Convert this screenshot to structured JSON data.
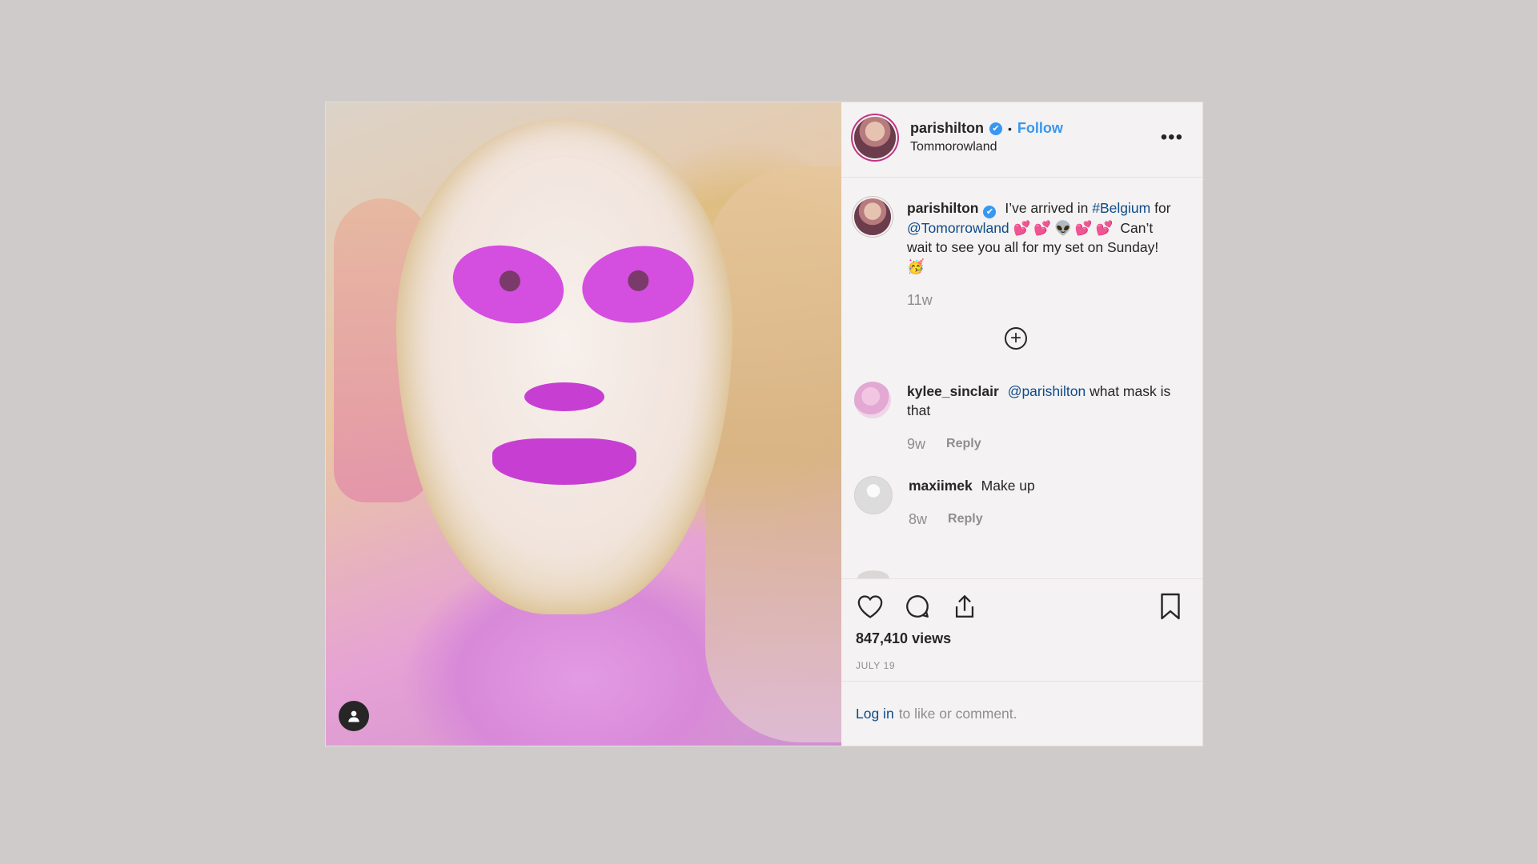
{
  "post": {
    "author": {
      "username": "parishilton",
      "verified_badge": "✔",
      "separator": "•",
      "follow_label": "Follow",
      "location": "Tommorowland"
    },
    "more_options": "•••",
    "caption": {
      "username": "parishilton",
      "verified_badge": "✔",
      "text_1": "I’ve arrived in",
      "hashtag": "#Belgium",
      "text_2": "for",
      "mention": "@Tomorrowland",
      "emojis": "💕💕👽💕💕",
      "text_3": "Can’t wait to see you all for my set on Sunday!",
      "trailing_emoji": "🥳",
      "time": "11w"
    },
    "comments": [
      {
        "username": "kylee_sinclair",
        "mention": "@parishilton",
        "text": "what mask is that",
        "time": "9w",
        "reply_label": "Reply"
      },
      {
        "username": "maxiimek",
        "text": "Make up",
        "time": "8w",
        "reply_label": "Reply"
      }
    ],
    "stats": {
      "views": "847,410 views",
      "date": "JULY 19"
    },
    "login_prompt": {
      "link": "Log in",
      "text": "to like or comment."
    }
  },
  "colors": {
    "accent": "#3897f0",
    "link": "#0e4b8a",
    "text": "#262626",
    "muted": "#8e8e8e",
    "background": "#cfcbcb"
  },
  "icons": [
    "user-tag-icon",
    "verified-icon",
    "more-icon",
    "load-more-icon",
    "heart-icon",
    "comment-icon",
    "share-icon",
    "bookmark-icon"
  ]
}
